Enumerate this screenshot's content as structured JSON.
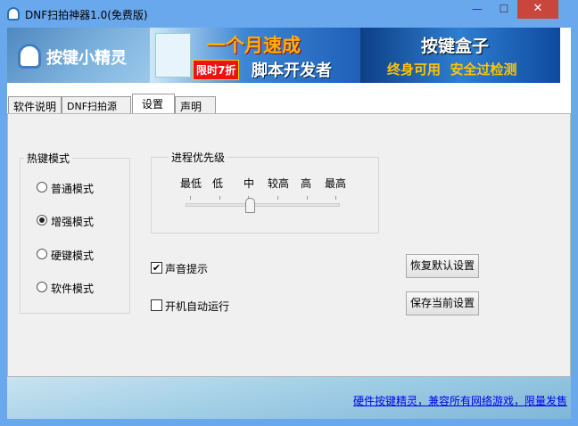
{
  "window": {
    "title": "DNF扫拍神器1.0(免费版)",
    "minimize": "—",
    "maximize": "☐",
    "close": "✕"
  },
  "banner": {
    "logo": "按键小精灵",
    "ad1_main": "一个月速成",
    "ad1_badge": "限时7折",
    "ad1_sub": "脚本开发者",
    "ad2_title": "按键盒子",
    "ad2_sub": "终身可用  安全过检测"
  },
  "tabs": [
    {
      "label": "软件说明"
    },
    {
      "label": "DNF扫拍源码"
    },
    {
      "label": "设置"
    },
    {
      "label": "声明"
    }
  ],
  "hotkey": {
    "title": "热键模式",
    "options": [
      "普通模式",
      "增强模式",
      "硬键模式",
      "软件模式"
    ],
    "selected": 1
  },
  "priority": {
    "title": "进程优先级",
    "levels": [
      "最低",
      "低",
      "中",
      "较高",
      "高",
      "最高"
    ],
    "selected": 2
  },
  "checks": [
    {
      "label": "声音提示",
      "checked": true
    },
    {
      "label": "开机自动运行",
      "checked": false
    }
  ],
  "buttons": {
    "restore": "恢复默认设置",
    "save": "保存当前设置"
  },
  "footer": {
    "link": "硬件按键精灵，兼容所有网络游戏，限量发售"
  }
}
